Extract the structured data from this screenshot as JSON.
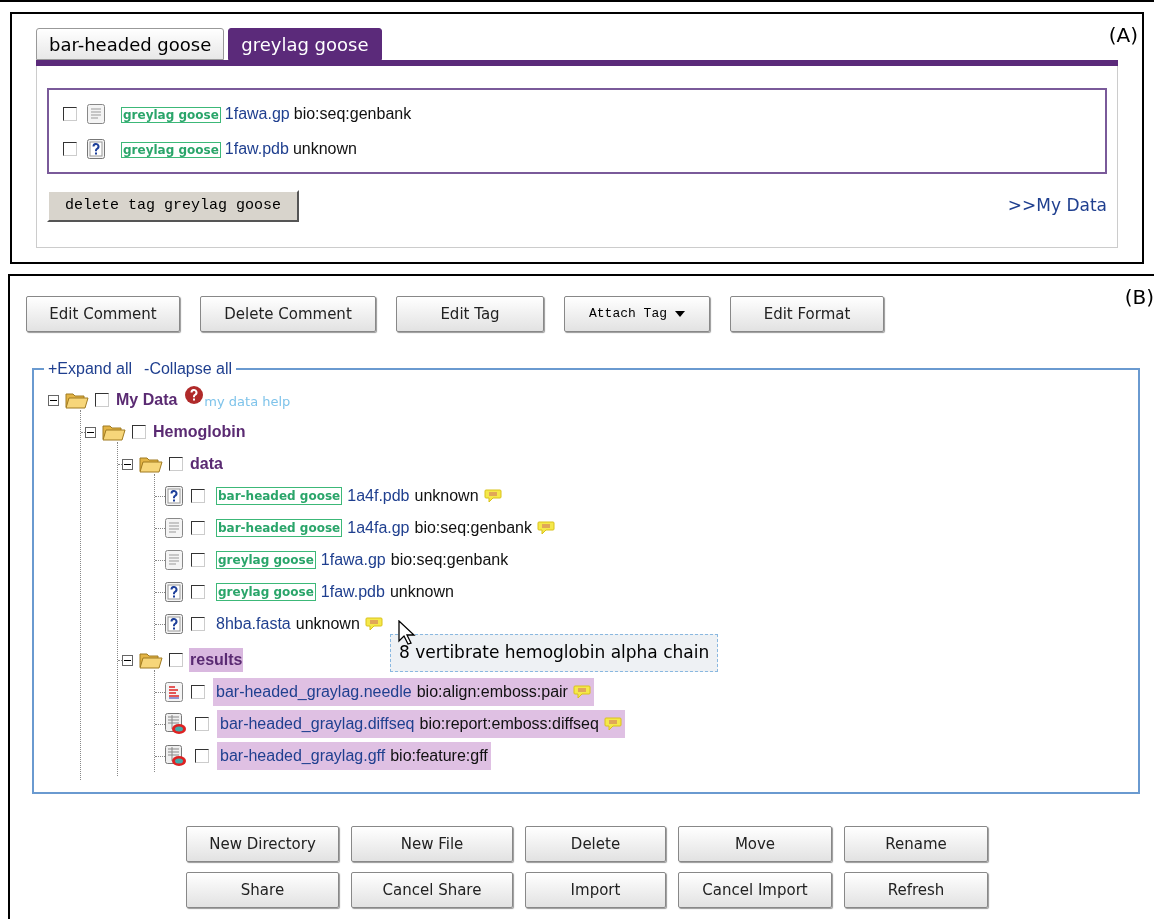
{
  "panel_a": {
    "label": "(A)",
    "tabs": [
      {
        "label": "bar-headed goose",
        "selected": false
      },
      {
        "label": "greylag goose",
        "selected": true
      }
    ],
    "items": [
      {
        "kind": "text_file",
        "checked": false,
        "tag": "greylag goose",
        "name": "1fawa.gp",
        "format": "bio:seq:genbank"
      },
      {
        "kind": "unknown_file",
        "checked": false,
        "tag": "greylag goose",
        "name": "1faw.pdb",
        "format": "unknown"
      }
    ],
    "delete_button": "delete tag greylag goose",
    "link": ">>My Data"
  },
  "panel_b": {
    "label": "(B)",
    "toolbar": [
      {
        "label": "Edit Comment",
        "kind": "plain"
      },
      {
        "label": "Delete Comment",
        "kind": "plain"
      },
      {
        "label": "Edit Tag",
        "kind": "plain"
      },
      {
        "label": "Attach Tag",
        "kind": "dropdown"
      },
      {
        "label": "Edit Format",
        "kind": "plain"
      }
    ],
    "expand_all": "+Expand all",
    "collapse_all": "-Collapse all",
    "tree": [
      {
        "kind": "folder",
        "label": "My Data",
        "expanded": true,
        "checked": false,
        "highlighted": false,
        "help": "my data help",
        "children": [
          {
            "kind": "folder",
            "label": "Hemoglobin",
            "expanded": true,
            "checked": false,
            "highlighted": false,
            "children": [
              {
                "kind": "folder",
                "label": "data",
                "expanded": true,
                "checked": false,
                "highlighted": false,
                "children": [
                  {
                    "kind": "unknown_file",
                    "checked": false,
                    "highlighted": false,
                    "tag": "bar-headed goose",
                    "name": "1a4f.pdb",
                    "format": "unknown",
                    "comment": true
                  },
                  {
                    "kind": "text_file",
                    "checked": false,
                    "highlighted": false,
                    "tag": "bar-headed goose",
                    "name": "1a4fa.gp",
                    "format": "bio:seq:genbank",
                    "comment": true
                  },
                  {
                    "kind": "text_file",
                    "checked": false,
                    "highlighted": false,
                    "tag": "greylag goose",
                    "name": "1fawa.gp",
                    "format": "bio:seq:genbank",
                    "comment": false
                  },
                  {
                    "kind": "unknown_file",
                    "checked": false,
                    "highlighted": false,
                    "tag": "greylag goose",
                    "name": "1faw.pdb",
                    "format": "unknown",
                    "comment": false
                  },
                  {
                    "kind": "unknown_file",
                    "checked": false,
                    "highlighted": false,
                    "name": "8hba.fasta",
                    "format": "unknown",
                    "comment": true
                  }
                ]
              },
              {
                "kind": "folder",
                "label": "results",
                "expanded": true,
                "checked": false,
                "highlighted": true,
                "children": [
                  {
                    "kind": "alignment_file",
                    "checked": false,
                    "highlighted": true,
                    "name": "bar-headed_graylag.needle",
                    "format": "bio:align:emboss:pair",
                    "comment": true
                  },
                  {
                    "kind": "report_file",
                    "checked": false,
                    "highlighted": true,
                    "name": "bar-headed_graylag.diffseq",
                    "format": "bio:report:emboss:diffseq",
                    "comment": true
                  },
                  {
                    "kind": "report_file",
                    "checked": false,
                    "highlighted": true,
                    "name": "bar-headed_graylag.gff",
                    "format": "bio:feature:gff",
                    "comment": false
                  }
                ]
              }
            ]
          }
        ]
      }
    ],
    "tooltip": "8 vertibrate hemoglobin alpha chain",
    "actions": [
      [
        "New Directory",
        "New File",
        "Delete",
        "Move",
        "Rename"
      ],
      [
        "Share",
        "Cancel Share",
        "Import",
        "Cancel Import",
        "Refresh"
      ]
    ]
  }
}
